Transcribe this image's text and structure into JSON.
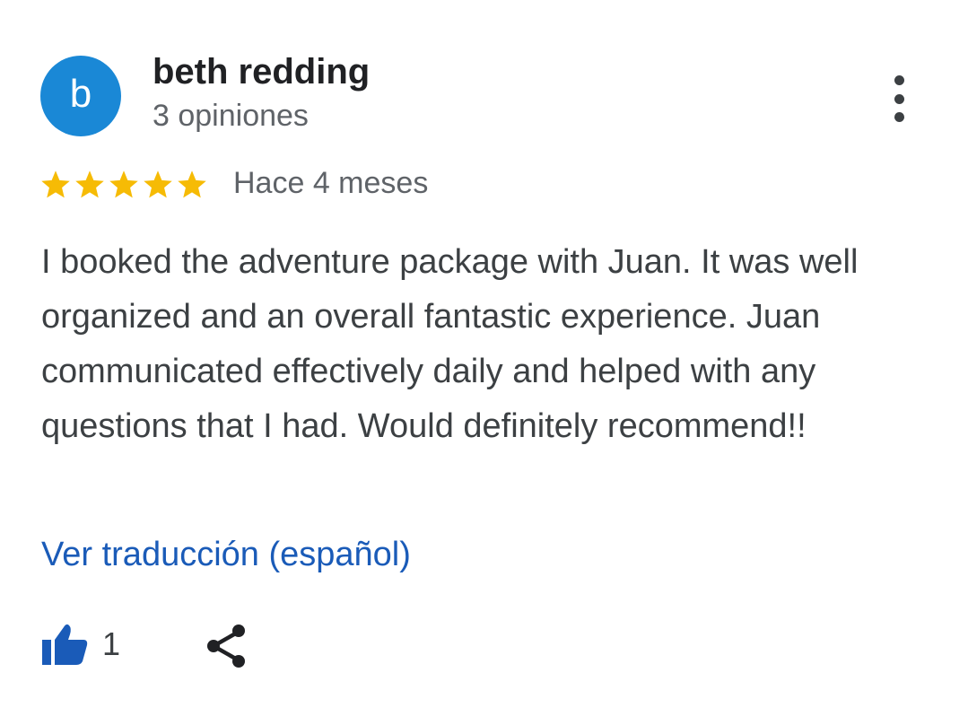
{
  "reviewer": {
    "avatar_letter": "b",
    "avatar_color": "#1a88d6",
    "name": "beth redding",
    "review_count": "3 opiniones"
  },
  "review": {
    "rating": 5,
    "max_rating": 5,
    "star_color": "#f6bb05",
    "date": "Hace 4 meses",
    "text": "I booked the adventure package with Juan. It was well organized and an overall fantastic experience. Juan communicated effectively daily and helped with any questions that I had. Would definitely recommend!!",
    "translate_label": "Ver traducción (español)",
    "link_color": "#1a5bb8"
  },
  "actions": {
    "like_count": "1",
    "like_icon": "thumbs-up-icon",
    "share_icon": "share-icon",
    "more_icon": "more-vertical-icon"
  }
}
